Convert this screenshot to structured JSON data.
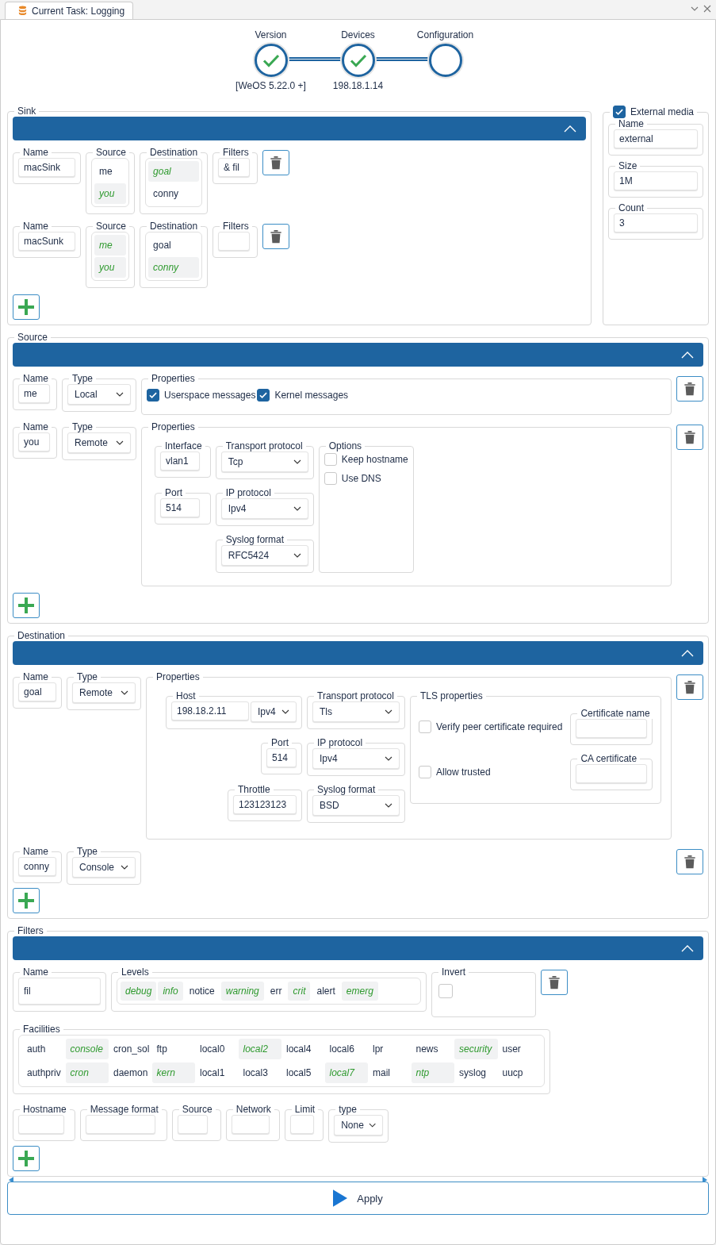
{
  "tab": {
    "title": "Current Task: Logging"
  },
  "steps": [
    {
      "label": "Version",
      "sub": "[WeOS 5.22.0 +]",
      "done": true
    },
    {
      "label": "Devices",
      "sub": "198.18.1.14",
      "done": true
    },
    {
      "label": "Configuration",
      "done": false
    }
  ],
  "sink": {
    "title": "Sink",
    "expanded": true,
    "rows": [
      {
        "name_label": "Name",
        "name": "macSink",
        "source_label": "Source",
        "sources": [
          {
            "label": "me",
            "selected": false
          },
          {
            "label": "you",
            "selected": true
          }
        ],
        "destination_label": "Destination",
        "destinations": [
          {
            "label": "goal",
            "selected": true
          },
          {
            "label": "conny",
            "selected": false
          }
        ],
        "filters_label": "Filters",
        "filters": "& fil"
      },
      {
        "name_label": "Name",
        "name": "macSunk",
        "source_label": "Source",
        "sources": [
          {
            "label": "me",
            "selected": true
          },
          {
            "label": "you",
            "selected": true
          }
        ],
        "destination_label": "Destination",
        "destinations": [
          {
            "label": "goal",
            "selected": false
          },
          {
            "label": "conny",
            "selected": true
          }
        ],
        "filters_label": "Filters",
        "filters": ""
      }
    ]
  },
  "external_media": {
    "label": "External media",
    "checked": true,
    "fields": [
      {
        "label": "Name",
        "value": "external"
      },
      {
        "label": "Size",
        "value": "1M"
      },
      {
        "label": "Count",
        "value": "3"
      }
    ]
  },
  "source": {
    "title": "Source",
    "expanded": true,
    "rows": [
      {
        "kind": "local",
        "name_label": "Name",
        "name": "me",
        "type_label": "Type",
        "type": "Local",
        "properties_label": "Properties",
        "checks": [
          {
            "label": "Userspace messages",
            "checked": true
          },
          {
            "label": "Kernel messages",
            "checked": true
          }
        ]
      },
      {
        "kind": "remote",
        "name_label": "Name",
        "name": "you",
        "type_label": "Type",
        "type": "Remote",
        "properties_label": "Properties",
        "interface_label": "Interface",
        "interface": "vlan1",
        "port_label": "Port",
        "port": "514",
        "transport_label": "Transport protocol",
        "transport": "Tcp",
        "ip_label": "IP protocol",
        "ip": "Ipv4",
        "format_label": "Syslog format",
        "format": "RFC5424",
        "options_label": "Options",
        "options": [
          {
            "label": "Keep hostname",
            "checked": false
          },
          {
            "label": "Use DNS",
            "checked": false
          }
        ]
      }
    ]
  },
  "destination": {
    "title": "Destination",
    "expanded": true,
    "rows": [
      {
        "kind": "remote",
        "name_label": "Name",
        "name": "goal",
        "type_label": "Type",
        "type": "Remote",
        "properties_label": "Properties",
        "host_label": "Host",
        "host": "198.18.2.11",
        "host_ip": "Ipv4",
        "port_label": "Port",
        "port": "514",
        "throttle_label": "Throttle",
        "throttle": "123123123",
        "transport_label": "Transport protocol",
        "transport": "Tls",
        "ip_label": "IP protocol",
        "ip": "Ipv4",
        "format_label": "Syslog format",
        "format": "BSD",
        "tls_label": "TLS properties",
        "verify": {
          "label": "Verify peer certificate required",
          "checked": false
        },
        "trusted": {
          "label": "Allow trusted",
          "checked": false
        },
        "cert_name_label": "Certificate name",
        "ca_label": "CA certificate"
      },
      {
        "kind": "console",
        "name_label": "Name",
        "name": "conny",
        "type_label": "Type",
        "type": "Console"
      }
    ]
  },
  "filters": {
    "title": "Filters",
    "expanded": true,
    "rows": [
      {
        "name_label": "Name",
        "name": "fil",
        "levels_label": "Levels",
        "levels": [
          {
            "label": "debug",
            "selected": true
          },
          {
            "label": "info",
            "selected": true
          },
          {
            "label": "notice",
            "selected": false
          },
          {
            "label": "warning",
            "selected": true
          },
          {
            "label": "err",
            "selected": false
          },
          {
            "label": "crit",
            "selected": true
          },
          {
            "label": "alert",
            "selected": false
          },
          {
            "label": "emerg",
            "selected": true
          }
        ],
        "invert_label": "Invert",
        "invert": false,
        "facilities_label": "Facilities",
        "facilities": [
          {
            "label": "auth",
            "selected": false
          },
          {
            "label": "console",
            "selected": true
          },
          {
            "label": "cron_sol",
            "selected": false
          },
          {
            "label": "ftp",
            "selected": false
          },
          {
            "label": "local0",
            "selected": false
          },
          {
            "label": "local2",
            "selected": true
          },
          {
            "label": "local4",
            "selected": false
          },
          {
            "label": "local6",
            "selected": false
          },
          {
            "label": "lpr",
            "selected": false
          },
          {
            "label": "news",
            "selected": false
          },
          {
            "label": "security",
            "selected": true
          },
          {
            "label": "user",
            "selected": false
          },
          {
            "label": "authpriv",
            "selected": false
          },
          {
            "label": "cron",
            "selected": true
          },
          {
            "label": "daemon",
            "selected": false
          },
          {
            "label": "kern",
            "selected": true
          },
          {
            "label": "local1",
            "selected": false
          },
          {
            "label": "local3",
            "selected": false
          },
          {
            "label": "local5",
            "selected": false
          },
          {
            "label": "local7",
            "selected": true
          },
          {
            "label": "mail",
            "selected": false
          },
          {
            "label": "ntp",
            "selected": true
          },
          {
            "label": "syslog",
            "selected": false
          },
          {
            "label": "uucp",
            "selected": false
          }
        ],
        "extra": [
          {
            "kind": "text",
            "label": "Hostname"
          },
          {
            "kind": "text",
            "label": "Message format"
          },
          {
            "kind": "text",
            "label": "Source"
          },
          {
            "kind": "text",
            "label": "Network"
          },
          {
            "kind": "text",
            "label": "Limit"
          },
          {
            "kind": "select",
            "label": "type",
            "value": "None"
          }
        ]
      }
    ]
  },
  "apply": "Apply"
}
